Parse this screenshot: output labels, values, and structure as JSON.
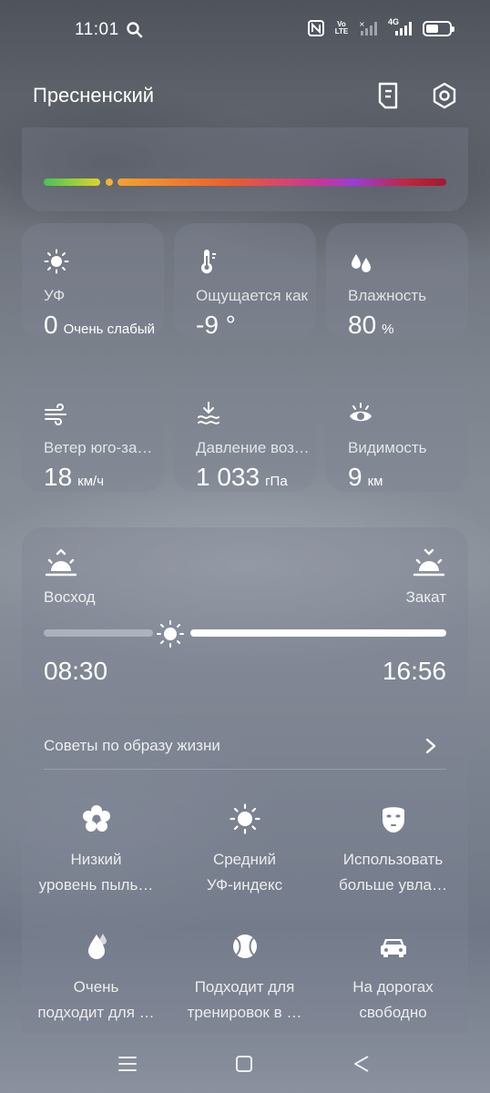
{
  "status_bar": {
    "time": "11:01",
    "volte_top": "Vo",
    "volte_bottom": "LTE",
    "network": "4G"
  },
  "header": {
    "location": "Пресненский"
  },
  "air_quality": {
    "level_fraction": 0.16
  },
  "tiles": [
    {
      "label": "УФ",
      "value": "0",
      "unit": "Очень слабый",
      "icon": "sun-icon"
    },
    {
      "label": "Ощущается как",
      "value": "-9 °",
      "unit": "",
      "icon": "thermometer-icon"
    },
    {
      "label": "Влажность",
      "value": "80",
      "unit": "%",
      "icon": "droplets-icon"
    },
    {
      "label": "Ветер юго-западный",
      "value": "18",
      "unit": "км/ч",
      "icon": "wind-icon"
    },
    {
      "label": "Давление воздуха",
      "value": "1 033",
      "unit": "гПа",
      "icon": "pressure-icon"
    },
    {
      "label": "Видимость",
      "value": "9",
      "unit": "км",
      "icon": "eye-icon"
    }
  ],
  "sun": {
    "sunrise_label": "Восход",
    "sunset_label": "Закат",
    "sunrise_time": "08:30",
    "sunset_time": "16:56",
    "progress_fraction": 0.3
  },
  "lifestyle": {
    "title": "Советы по образу жизни",
    "items": [
      {
        "text": "Низкий\nуровень пыль…",
        "icon": "flower-icon"
      },
      {
        "text": "Средний\nУФ-индекс",
        "icon": "sun-icon"
      },
      {
        "text": "Использовать\nбольше увла…",
        "icon": "face-mask-icon"
      },
      {
        "text": "Очень\nподходит для …",
        "icon": "drop-icon"
      },
      {
        "text": "Подходит для\nтренировок в …",
        "icon": "ball-icon"
      },
      {
        "text": "На дорогах\nсвободно",
        "icon": "car-icon"
      }
    ]
  }
}
